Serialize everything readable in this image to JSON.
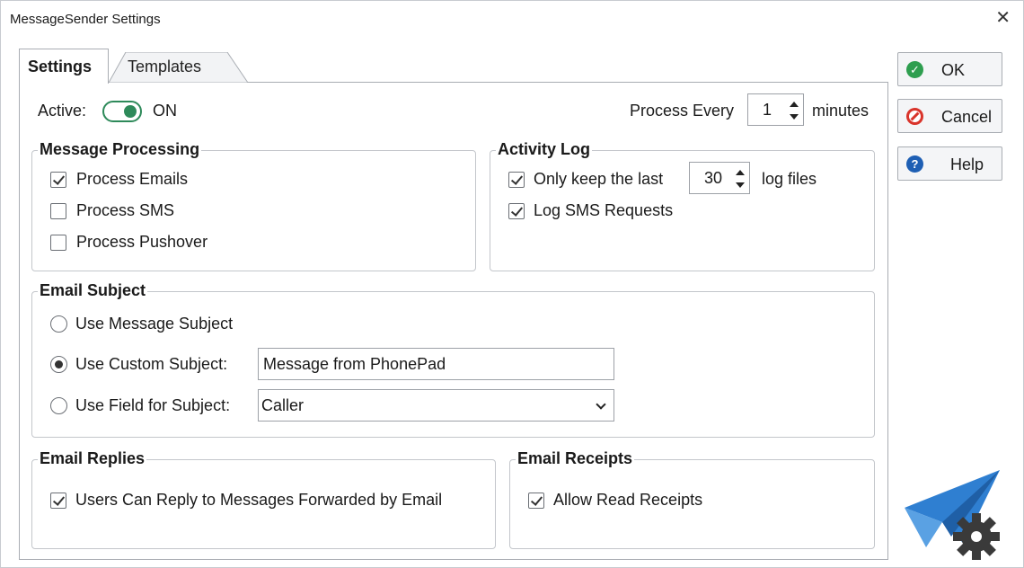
{
  "window": {
    "title": "MessageSender Settings",
    "close_glyph": "✕"
  },
  "tabs": [
    {
      "label": "Settings",
      "active": true
    },
    {
      "label": "Templates",
      "active": false
    }
  ],
  "general": {
    "active_label": "Active:",
    "active_state": "ON",
    "process_every_label": "Process Every",
    "process_every_value": "1",
    "process_every_unit": "minutes"
  },
  "message_processing": {
    "title": "Message Processing",
    "items": [
      {
        "label": "Process Emails",
        "checked": true
      },
      {
        "label": "Process SMS",
        "checked": false
      },
      {
        "label": "Process Pushover",
        "checked": false
      }
    ]
  },
  "activity_log": {
    "title": "Activity Log",
    "keep_label": "Only keep the last",
    "keep_value": "30",
    "keep_unit": "log files",
    "keep_checked": true,
    "log_sms_label": "Log SMS Requests",
    "log_sms_checked": true
  },
  "email_subject": {
    "title": "Email Subject",
    "options": [
      {
        "label": "Use Message Subject",
        "selected": false
      },
      {
        "label": "Use Custom Subject:",
        "selected": true
      },
      {
        "label": "Use Field for Subject:",
        "selected": false
      }
    ],
    "custom_subject_value": "Message from PhonePad",
    "field_value": "Caller"
  },
  "email_replies": {
    "title": "Email Replies",
    "label": "Users Can Reply to Messages Forwarded by Email",
    "checked": true
  },
  "email_receipts": {
    "title": "Email Receipts",
    "label": "Allow Read Receipts",
    "checked": true
  },
  "buttons": {
    "ok": "OK",
    "cancel": "Cancel",
    "help": "Help"
  },
  "colors": {
    "toggle_on": "#2e8a5a",
    "ok_icon": "#2e9e4f",
    "cancel_icon": "#d9342b",
    "help_icon": "#1e5fb4",
    "logo_blue": "#2f7fd1",
    "logo_gear": "#3a3a3a"
  },
  "icons": {
    "ok": "check-circle-icon",
    "cancel": "no-entry-icon",
    "help": "question-circle-icon",
    "logo": "paper-plane-gear-icon"
  }
}
